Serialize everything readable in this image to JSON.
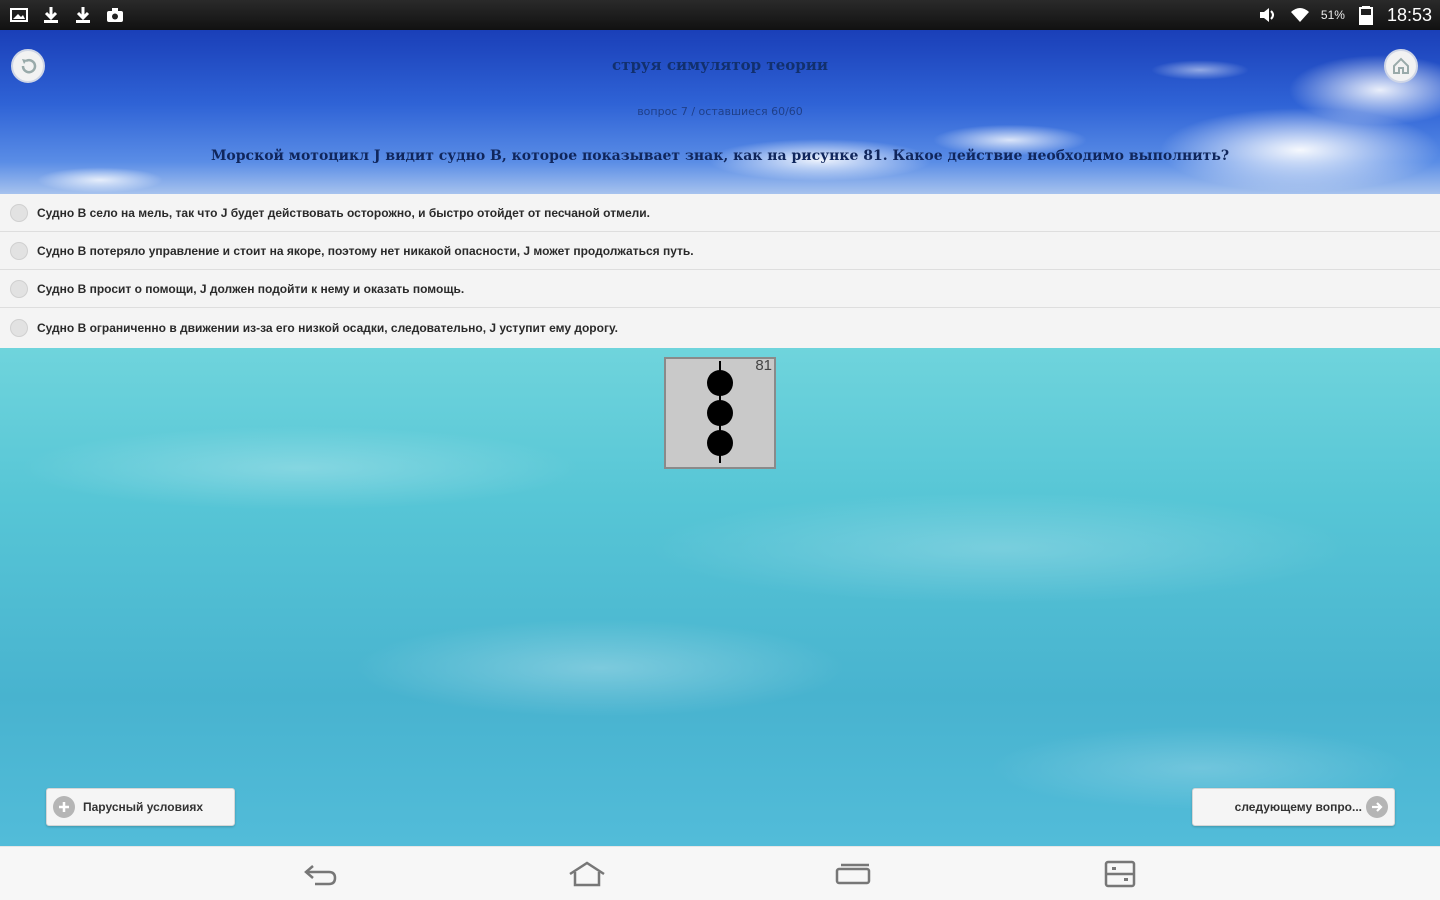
{
  "status_bar": {
    "left_icons": [
      "gallery-icon",
      "download-icon",
      "download-icon",
      "camera-icon"
    ],
    "right_icons": [
      "volume-icon",
      "wifi-icon",
      "battery-icon"
    ],
    "battery": "51%",
    "time": "18:53"
  },
  "header": {
    "title": "струя симулятор теории",
    "meta": "вопрос 7 / оставшиеся 60/60",
    "question": "Морской мотоцикл J видит судно B, которое показывает знак, как на рисунке 81. Какое действие необходимо выполнить?"
  },
  "answers": [
    {
      "label": "Судно B село на мель, так что J будет действовать осторожно, и быстро отойдет от песчаной отмели."
    },
    {
      "label": "Судно B потеряло управление и стоит на якоре, поэтому нет никакой опасности, J может продолжаться путь."
    },
    {
      "label": "Судно B просит о помощи, J должен подойти к нему и оказать помощь."
    },
    {
      "label": "Судно B ограниченно в движении из-за его низкой осадки, следовательно, J уступит ему дорогу."
    }
  ],
  "figure": {
    "number": "81",
    "balls": 3
  },
  "buttons": {
    "left_label": "Парусный условиях",
    "right_label": "следующему вопро..."
  },
  "navbar": {
    "icons": [
      "back-nav-icon",
      "home-nav-icon",
      "recent-apps-icon",
      "multiwindow-icon"
    ]
  }
}
